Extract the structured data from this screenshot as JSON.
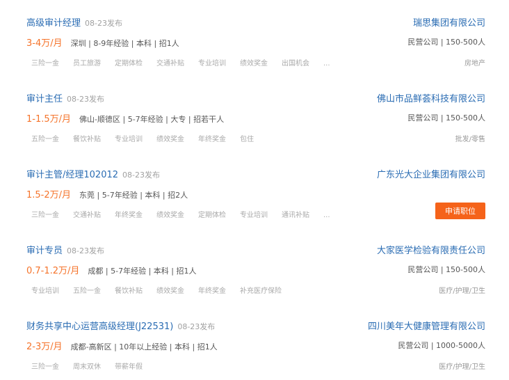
{
  "jobs": [
    {
      "title": "高级审计经理",
      "date": "08-23发布",
      "salary": "3-4万/月",
      "info": "深圳 | 8-9年经验 | 本科 | 招1人",
      "tags": [
        "三险一金",
        "员工旅游",
        "定期体检",
        "交通补贴",
        "专业培训",
        "绩效奖金",
        "出国机会",
        "..."
      ],
      "company": "瑞思集团有限公司",
      "company_type": "民营公司 | 150-500人",
      "industry": "房地产"
    },
    {
      "title": "审计主任",
      "date": "08-23发布",
      "salary": "1-1.5万/月",
      "info": "佛山-顺德区 | 5-7年经验 | 大专 | 招若干人",
      "tags": [
        "五险一金",
        "餐饮补贴",
        "专业培训",
        "绩效奖金",
        "年终奖金",
        "包住"
      ],
      "company": "佛山市品鲜荟科技有限公司",
      "company_type": "民营公司 | 150-500人",
      "industry": "批发/零售"
    },
    {
      "title": "审计主管/经理102012",
      "date": "08-23发布",
      "salary": "1.5-2万/月",
      "info": "东莞 | 5-7年经验 | 本科 | 招2人",
      "tags": [
        "三险一金",
        "交通补贴",
        "年终奖金",
        "绩效奖金",
        "定期体检",
        "专业培训",
        "通讯补贴",
        "..."
      ],
      "company": "广东光大企业集团有限公司",
      "apply_label": "申请职位"
    },
    {
      "title": "审计专员",
      "date": "08-23发布",
      "salary": "0.7-1.2万/月",
      "info": "成都 | 5-7年经验 | 本科 | 招1人",
      "tags": [
        "专业培训",
        "五险一金",
        "餐饮补贴",
        "绩效奖金",
        "年终奖金",
        "补充医疗保险"
      ],
      "company": "大家医学检验有限责任公司",
      "company_type": "民营公司 | 150-500人",
      "industry": "医疗/护理/卫生"
    },
    {
      "title": "财务共享中心运营高级经理(J22531)",
      "date": "08-23发布",
      "salary": "2-3万/月",
      "info": "成都-高新区 | 10年以上经验 | 本科 | 招1人",
      "tags": [
        "三险一金",
        "周末双休",
        "带薪年假"
      ],
      "company": "四川美年大健康管理有限公司",
      "company_type": "民营公司 | 1000-5000人",
      "industry": "医疗/护理/卫生"
    }
  ]
}
